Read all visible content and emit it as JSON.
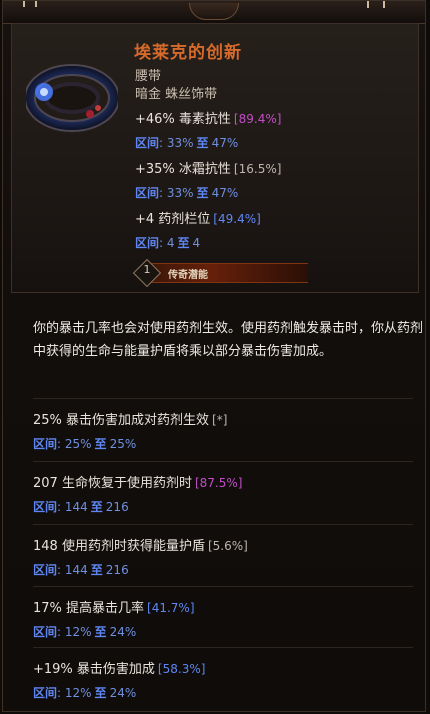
{
  "item": {
    "name": "埃莱克的创新",
    "type": "腰带",
    "base": "暗金 蛛丝饰带",
    "colors": {
      "name": "#d66a2b",
      "range": "#5f86f2",
      "stat": "#e9e3db",
      "purple": "#c24ec6",
      "neutral": "#bdb6ae"
    }
  },
  "header_stats": [
    {
      "stat": "+46% 毒素抗性",
      "bracket": "[89.4%]",
      "bracket_color": "purple",
      "range_label": "区间",
      "range_from": "33%",
      "range_sep": "至",
      "range_to": "47%"
    },
    {
      "stat": "+35% 冰霜抗性",
      "bracket": "[16.5%]",
      "bracket_color": "neutral",
      "range_label": "区间",
      "range_from": "33%",
      "range_sep": "至",
      "range_to": "47%"
    },
    {
      "stat": "+4 药剂栏位",
      "bracket": "[49.4%]",
      "bracket_color": "range",
      "range_label": "区间",
      "range_from": "4",
      "range_sep": "至",
      "range_to": "4"
    }
  ],
  "potential": {
    "number": "1",
    "label": "传奇潜能"
  },
  "description": "你的暴击几率也会对使用药剂生效。使用药剂触发暴击时，你从药剂中获得的生命与能量护盾将乘以部分暴击伤害加成。",
  "affixes": [
    {
      "stat": "25% 暴击伤害加成对药剂生效",
      "bracket": "[*]",
      "bracket_color": "neutral",
      "range_label": "区间",
      "range_from": "25%",
      "range_sep": "至",
      "range_to": "25%"
    },
    {
      "stat": "207 生命恢复于使用药剂时",
      "bracket": "[87.5%]",
      "bracket_color": "purple",
      "range_label": "区间",
      "range_from": "144",
      "range_sep": "至",
      "range_to": "216"
    },
    {
      "stat": "148 使用药剂时获得能量护盾",
      "bracket": "[5.6%]",
      "bracket_color": "neutral",
      "range_label": "区间",
      "range_from": "144",
      "range_sep": "至",
      "range_to": "216"
    },
    {
      "stat": "17% 提高暴击几率",
      "bracket": "[41.7%]",
      "bracket_color": "range",
      "range_label": "区间",
      "range_from": "12%",
      "range_sep": "至",
      "range_to": "24%"
    },
    {
      "stat": "+19% 暴击伤害加成",
      "bracket": "[58.3%]",
      "bracket_color": "range",
      "range_label": "区间",
      "range_from": "12%",
      "range_sep": "至",
      "range_to": "24%"
    }
  ]
}
